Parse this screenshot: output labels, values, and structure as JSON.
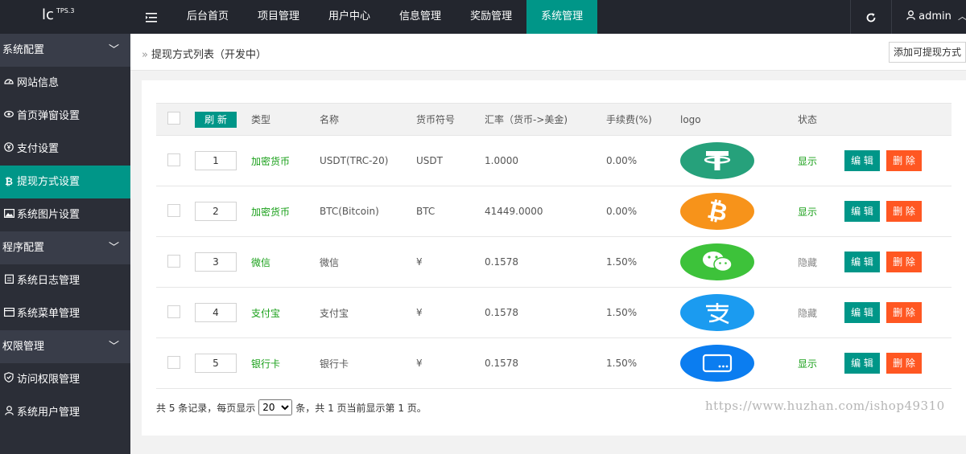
{
  "logo": {
    "text": "lc",
    "version": "TPS.3"
  },
  "nav": {
    "toggle_icon": "menu-fold-icon",
    "items": [
      {
        "label": "后台首页",
        "active": false
      },
      {
        "label": "项目管理",
        "active": false
      },
      {
        "label": "用户中心",
        "active": false
      },
      {
        "label": "信息管理",
        "active": false
      },
      {
        "label": "奖励管理",
        "active": false
      },
      {
        "label": "系统管理",
        "active": true
      }
    ],
    "refresh_icon": "refresh-icon",
    "user": "admin"
  },
  "sidebar": {
    "groups": [
      {
        "label": "系统配置",
        "items": [
          {
            "label": "网站信息",
            "icon": "dashboard-icon",
            "active": false
          },
          {
            "label": "首页弹窗设置",
            "icon": "eye-icon",
            "active": false
          },
          {
            "label": "支付设置",
            "icon": "yen-icon",
            "active": false
          },
          {
            "label": "提现方式设置",
            "icon": "bitcoin-icon",
            "active": true
          },
          {
            "label": "系统图片设置",
            "icon": "picture-icon",
            "active": false
          }
        ]
      },
      {
        "label": "程序配置",
        "items": [
          {
            "label": "系统日志管理",
            "icon": "clipboard-icon",
            "active": false
          },
          {
            "label": "系统菜单管理",
            "icon": "window-icon",
            "active": false
          }
        ]
      },
      {
        "label": "权限管理",
        "items": [
          {
            "label": "访问权限管理",
            "icon": "shield-icon",
            "active": false
          },
          {
            "label": "系统用户管理",
            "icon": "user-icon",
            "active": false
          }
        ]
      }
    ]
  },
  "breadcrumb": {
    "title": "提现方式列表（开发中）"
  },
  "add_button": "添加可提现方式",
  "table": {
    "refresh_label": "刷 新",
    "columns": [
      "类型",
      "名称",
      "货币符号",
      "汇率（货币->美金)",
      "手续费(%)",
      "logo",
      "状态"
    ],
    "rows": [
      {
        "sort": "1",
        "type": "加密货币",
        "name": "USDT(TRC-20)",
        "symbol": "USDT",
        "rate": "1.0000",
        "fee": "0.00%",
        "logo": "tether-logo",
        "status": "显示",
        "status_color": "#1aa01a"
      },
      {
        "sort": "2",
        "type": "加密货币",
        "name": "BTC(Bitcoin)",
        "symbol": "BTC",
        "rate": "41449.0000",
        "fee": "0.00%",
        "logo": "bitcoin-logo",
        "status": "显示",
        "status_color": "#1aa01a"
      },
      {
        "sort": "3",
        "type": "微信",
        "name": "微信",
        "symbol": "¥",
        "rate": "0.1578",
        "fee": "1.50%",
        "logo": "wechat-logo",
        "status": "隐藏",
        "status_color": "#888888"
      },
      {
        "sort": "4",
        "type": "支付宝",
        "name": "支付宝",
        "symbol": "¥",
        "rate": "0.1578",
        "fee": "1.50%",
        "logo": "alipay-logo",
        "status": "隐藏",
        "status_color": "#888888"
      },
      {
        "sort": "5",
        "type": "银行卡",
        "name": "银行卡",
        "symbol": "¥",
        "rate": "0.1578",
        "fee": "1.50%",
        "logo": "bankcard-logo",
        "status": "显示",
        "status_color": "#1aa01a"
      }
    ],
    "edit_label": "编 辑",
    "delete_label": "删 除"
  },
  "pagination": {
    "prefix": "共 5 条记录，每页显示",
    "page_size": "20",
    "suffix": "条，共 1 页当前显示第 1 页。"
  },
  "watermark": "https://www.huzhan.com/ishop49310",
  "colors": {
    "accent": "#009688",
    "danger": "#ff5722",
    "topbar": "#23262e",
    "sidebar": "#2b2e37"
  }
}
